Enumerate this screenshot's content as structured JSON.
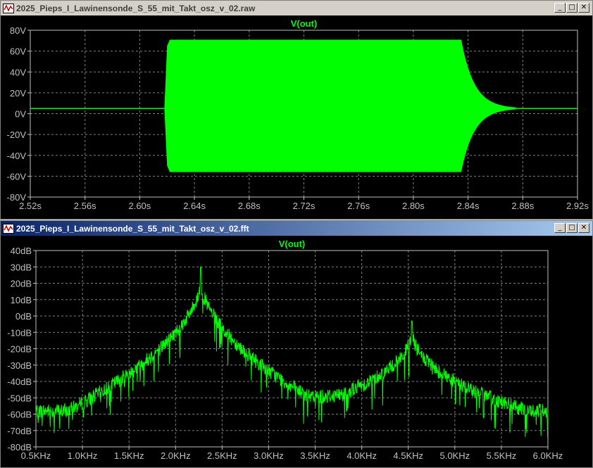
{
  "window1": {
    "title": "2025_Pieps_I_Lawinensonde_S_55_mit_Takt_osz_v_02.raw",
    "controls": {
      "minimize": "_",
      "maximize": "□",
      "close": "✕"
    },
    "trace_label": "V(out)",
    "colors": {
      "trace": "#00ff00",
      "axis": "#c0c0c0",
      "grid": "#808080"
    }
  },
  "window2": {
    "title": "2025_Pieps_I_Lawinensonde_S_55_mit_Takt_osz_v_02.fft",
    "controls": {
      "minimize": "_",
      "maximize": "□",
      "close": "✕"
    },
    "trace_label": "V(out)"
  },
  "chart_data": [
    {
      "type": "line",
      "title": "V(out)",
      "x_ticks": [
        "2.52s",
        "2.56s",
        "2.60s",
        "2.64s",
        "2.68s",
        "2.72s",
        "2.76s",
        "2.80s",
        "2.84s",
        "2.88s",
        "2.92s"
      ],
      "y_ticks": [
        "80V",
        "60V",
        "40V",
        "20V",
        "0V",
        "-20V",
        "-40V",
        "-60V",
        "-80V"
      ],
      "xlim": [
        2.52,
        2.92
      ],
      "ylim": [
        -80,
        80
      ],
      "grid": true,
      "series": [
        {
          "envelope": {
            "baseline": 5,
            "burst_start": 2.62,
            "burst_end": 2.835,
            "upper": 71,
            "lower": -56,
            "decay_end": 2.875
          }
        }
      ]
    },
    {
      "type": "line",
      "title": "V(out)",
      "x_ticks": [
        "0.5KHz",
        "1.0KHz",
        "1.5KHz",
        "2.0KHz",
        "2.5KHz",
        "3.0KHz",
        "3.5KHz",
        "4.0KHz",
        "4.5KHz",
        "5.0KHz",
        "5.5KHz",
        "6.0KHz"
      ],
      "y_ticks": [
        "40dB",
        "30dB",
        "20dB",
        "10dB",
        "0dB",
        "-10dB",
        "-20dB",
        "-30dB",
        "-40dB",
        "-50dB",
        "-60dB",
        "-70dB",
        "-80dB"
      ],
      "xlim": [
        0.5,
        6.0
      ],
      "ylim": [
        -80,
        40
      ],
      "grid": true,
      "series": [
        {
          "peaks": [
            {
              "freq_khz": 2.27,
              "db": 30
            },
            {
              "freq_khz": 4.54,
              "db": -3
            }
          ],
          "noise_floor_db": -60
        }
      ]
    }
  ]
}
